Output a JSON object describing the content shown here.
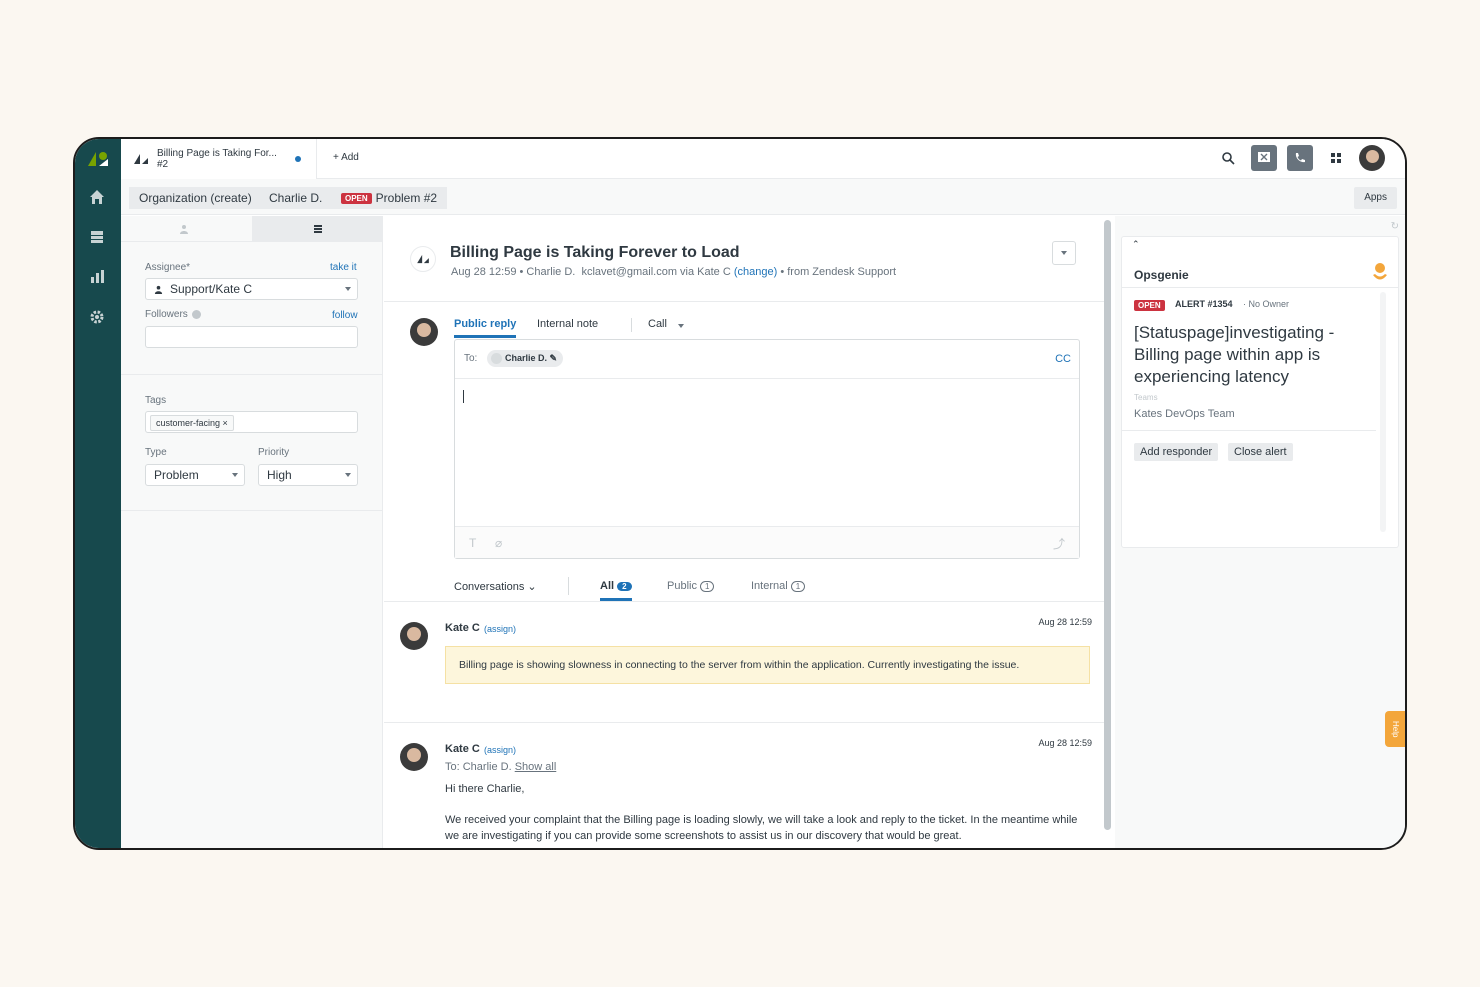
{
  "tab": {
    "title": "Billing Page is Taking For... #2",
    "add_label": "+ Add"
  },
  "breadcrumbs": {
    "org": "Organization (create)",
    "requester": "Charlie D.",
    "status_badge": "OPEN",
    "ticket": "Problem #2",
    "apps": "Apps"
  },
  "properties": {
    "assignee_label": "Assignee*",
    "take_it": "take it",
    "assignee_value": "Support/Kate C",
    "followers_label": "Followers",
    "follow": "follow",
    "tags_label": "Tags",
    "tag": "customer-facing ×",
    "type_label": "Type",
    "type_value": "Problem",
    "priority_label": "Priority",
    "priority_value": "High"
  },
  "ticket": {
    "title": "Billing Page is Taking Forever to Load",
    "meta_date": "Aug 28 12:59",
    "meta_requester": "Charlie D.",
    "meta_email": "kclavet@gmail.com",
    "meta_via": "via Kate C",
    "meta_change": "(change)",
    "meta_source": "from Zendesk Support"
  },
  "composer": {
    "tab_public": "Public reply",
    "tab_internal": "Internal note",
    "tab_call": "Call",
    "to_label": "To:",
    "to_chip": "Charlie D.",
    "cc": "CC"
  },
  "filters": {
    "conversations": "Conversations",
    "all": "All",
    "all_count": "2",
    "public": "Public",
    "public_count": "1",
    "internal": "Internal",
    "internal_count": "1"
  },
  "messages": [
    {
      "author": "Kate C",
      "assign": "(assign)",
      "time": "Aug 28 12:59",
      "body": "Billing page is showing slowness in connecting to the server from within the application. Currently investigating the issue."
    },
    {
      "author": "Kate C",
      "assign": "(assign)",
      "time": "Aug 28 12:59",
      "to": "To: Charlie D.",
      "show_all": "Show all",
      "greeting": "Hi there Charlie,",
      "body": "We received your complaint that the Billing page is loading slowly, we will take a look and reply to the ticket. In the meantime while we are investigating if you can provide some screenshots to assist us in our discovery that would be great."
    }
  ],
  "opsgenie": {
    "name": "Opsgenie",
    "status": "OPEN",
    "alert_id": "ALERT #1354",
    "owner": "No Owner",
    "title": "[Statuspage]investigating - Billing page within app is experiencing latency",
    "teams_label": "Teams",
    "team": "Kates DevOps Team",
    "add_responder": "Add responder",
    "close_alert": "Close alert"
  },
  "help": "Help",
  "colors": {
    "rail": "#17494d",
    "accent": "#1f73b7",
    "open_red": "#cc3340",
    "internal_note_bg": "#fdf6dc",
    "opsgenie_orange": "#f3a63b"
  }
}
